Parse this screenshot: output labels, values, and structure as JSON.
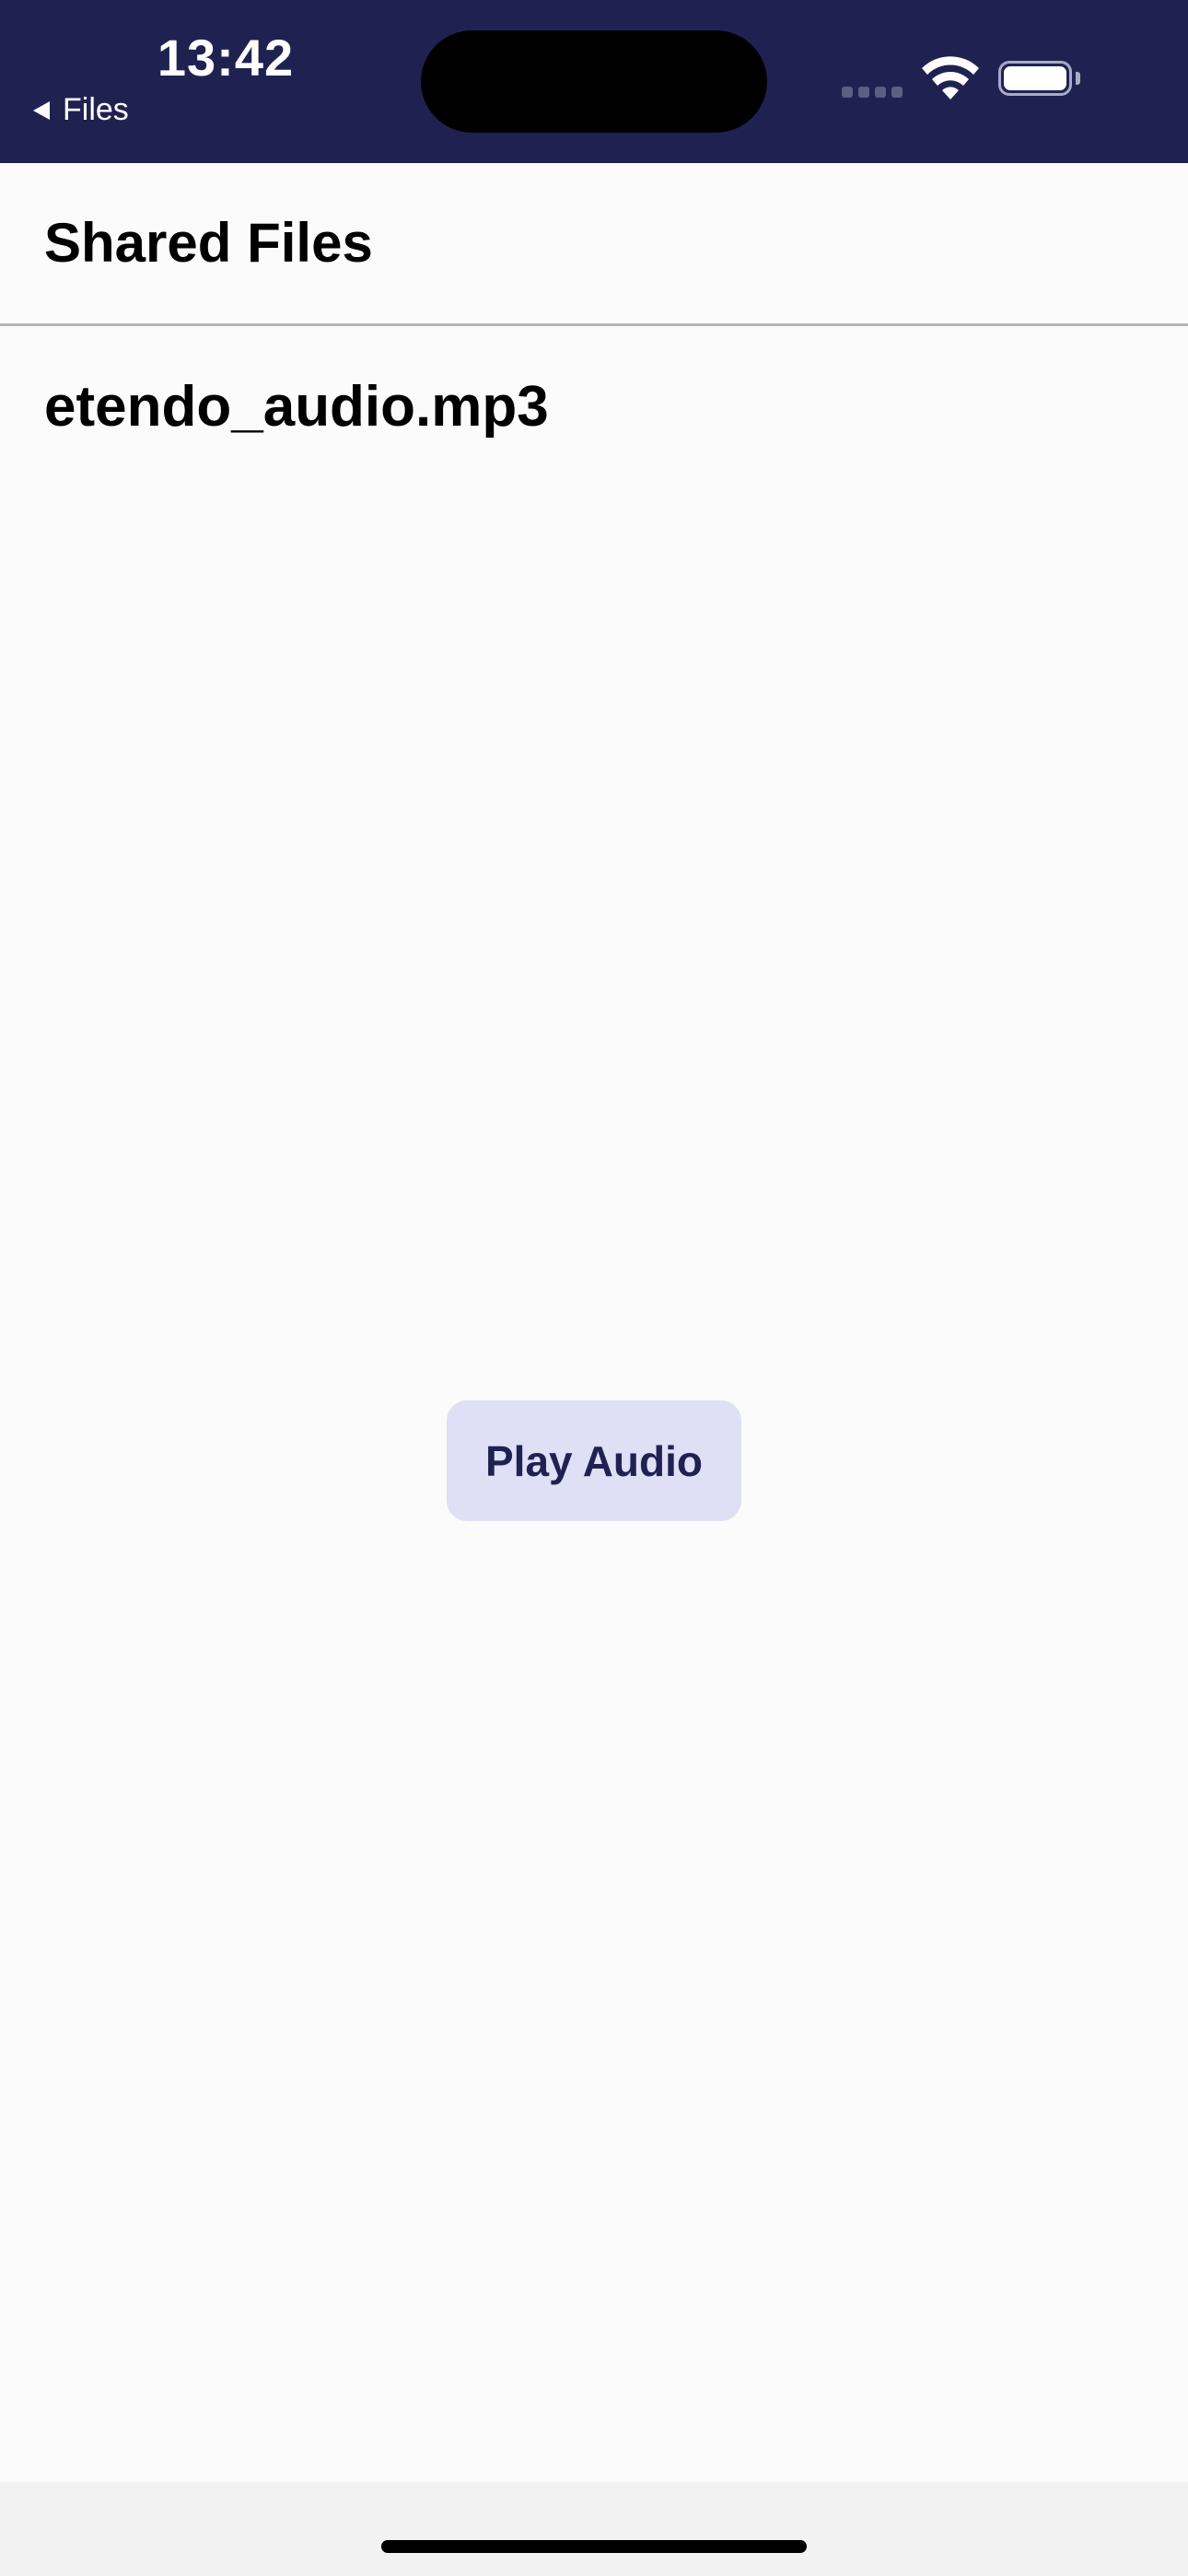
{
  "status_bar": {
    "time": "13:42",
    "back_label": "Files",
    "background_color": "#1f2251"
  },
  "header": {
    "title": "Shared Files"
  },
  "file": {
    "name": "etendo_audio.mp3"
  },
  "actions": {
    "play_label": "Play Audio",
    "button_color": "#dfe0f6",
    "button_text_color": "#1f2251"
  },
  "icons": {
    "back": "back-arrow-icon",
    "signal": "cellular-signal-icon",
    "wifi": "wifi-icon",
    "battery": "battery-icon"
  }
}
